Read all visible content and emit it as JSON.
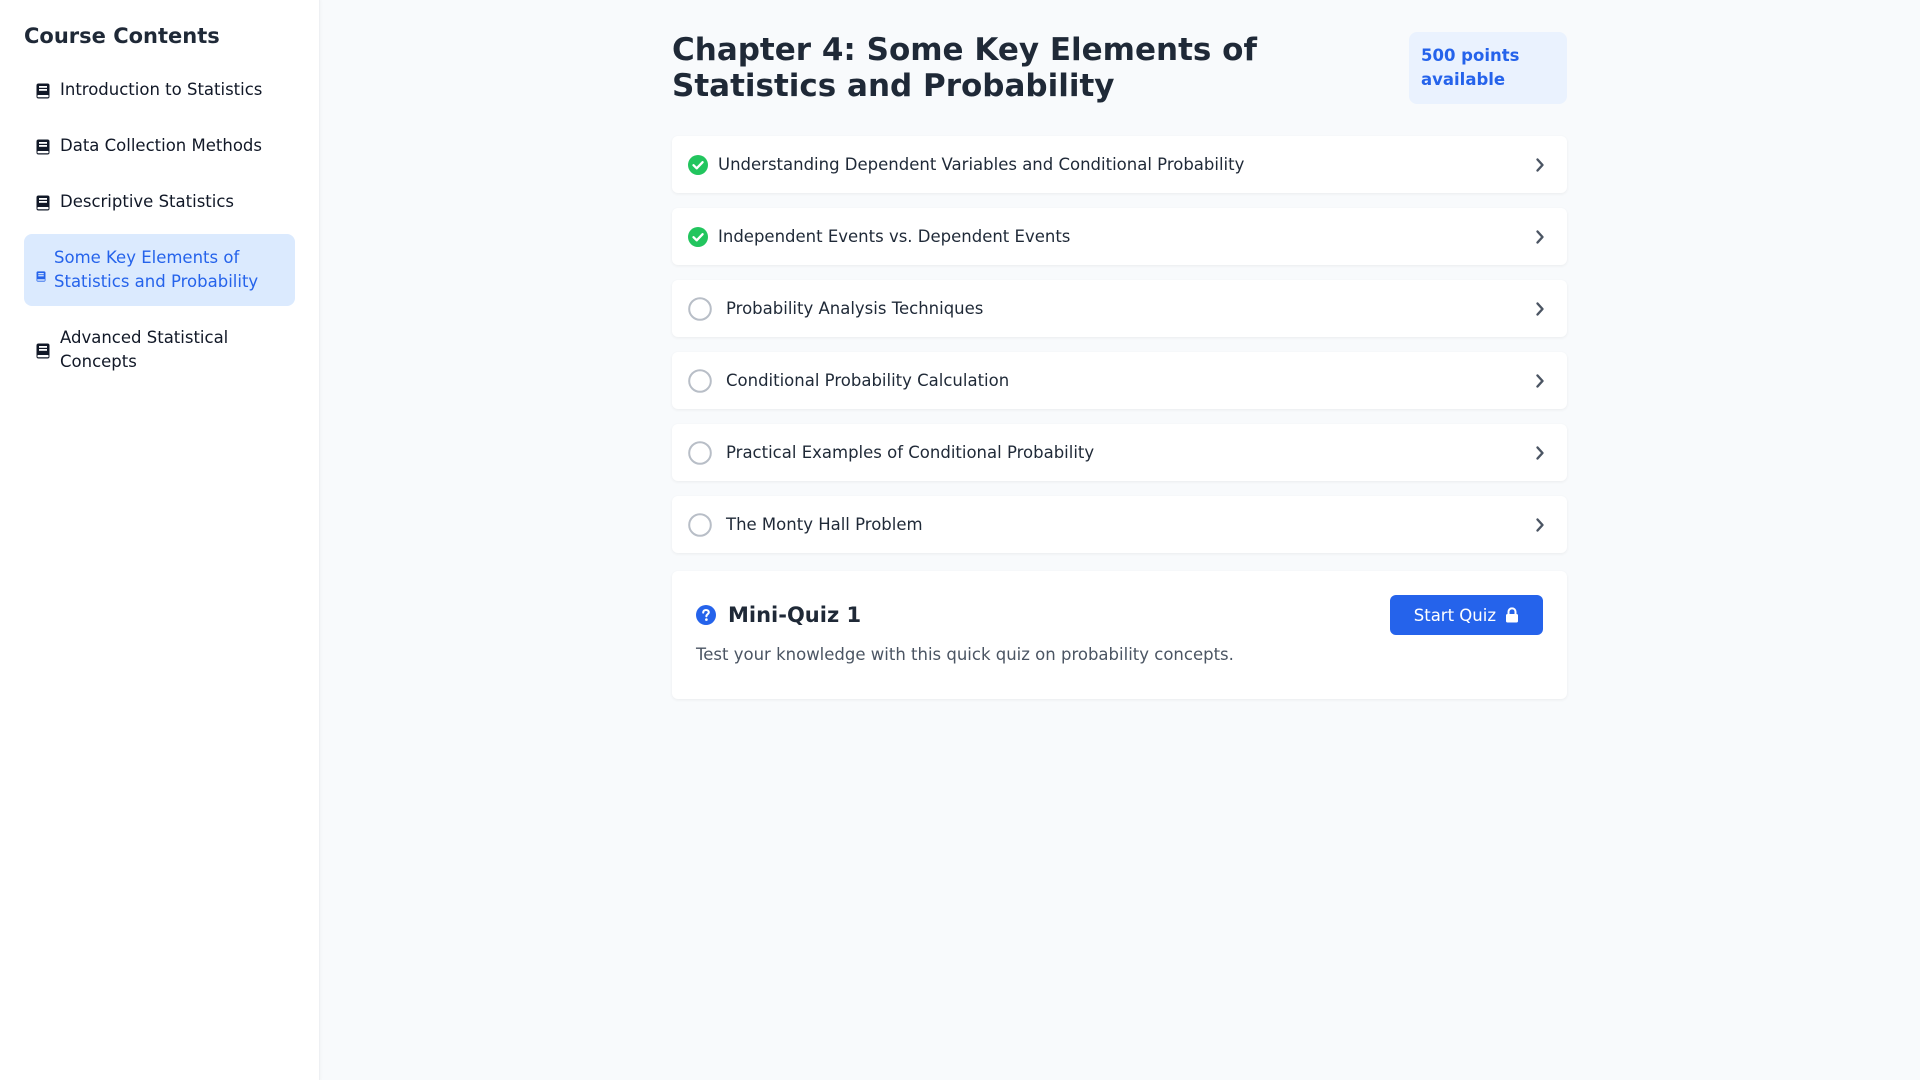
{
  "sidebar": {
    "title": "Course Contents",
    "items": [
      {
        "label": "Introduction to Statistics",
        "icon": "book-icon",
        "active": false
      },
      {
        "label": "Data Collection Methods",
        "icon": "book-icon",
        "active": false
      },
      {
        "label": "Descriptive Statistics",
        "icon": "book-icon",
        "active": false
      },
      {
        "label": "Some Key Elements of Statistics and Probability",
        "icon": "book-icon",
        "active": true
      },
      {
        "label": "Advanced Statistical Concepts",
        "icon": "book-icon",
        "active": false
      }
    ]
  },
  "main": {
    "chapter_title": "Chapter 4: Some Key Elements of Statistics and Probability",
    "points_badge": "500 points available",
    "lessons": [
      {
        "label": "Understanding Dependent Variables and Conditional Probability",
        "completed": true
      },
      {
        "label": "Independent Events vs. Dependent Events",
        "completed": true
      },
      {
        "label": "Probability Analysis Techniques",
        "completed": false
      },
      {
        "label": "Conditional Probability Calculation",
        "completed": false
      },
      {
        "label": "Practical Examples of Conditional Probability",
        "completed": false
      },
      {
        "label": "The Monty Hall Problem",
        "completed": false
      }
    ],
    "quiz": {
      "title": "Mini-Quiz 1",
      "button_label": "Start Quiz",
      "description": "Test your knowledge with this quick quiz on probability concepts.",
      "icon": "question-circle-icon",
      "button_icon": "lock-icon"
    }
  },
  "colors": {
    "accent": "#2563eb",
    "active_bg": "#dbeafe",
    "badge_bg": "#eaf2fe",
    "success": "#22c55e",
    "page_bg": "#f8fafc"
  }
}
